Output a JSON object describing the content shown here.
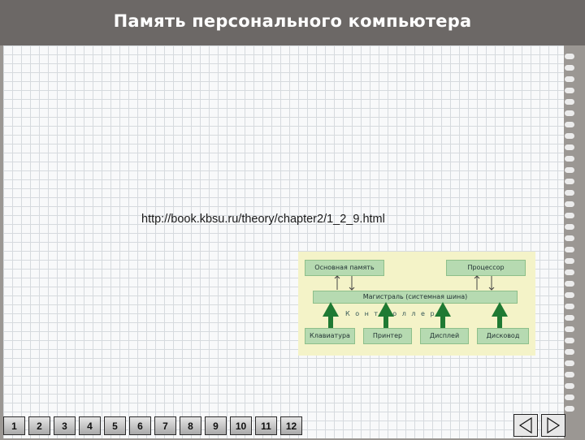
{
  "header": {
    "title": "Память персонального компьютера"
  },
  "content": {
    "url": "http://book.kbsu.ru/theory/chapter2/1_2_9.html"
  },
  "diagram": {
    "memory": "Основная память",
    "processor": "Процессор",
    "bus": "Магистраль (системная шина)",
    "controllers": "К о н т р о л л е р ы",
    "devices": [
      "Клавиатура",
      "Принтер",
      "Дисплей",
      "Дисковод"
    ]
  },
  "navigation": {
    "pages": [
      "1",
      "2",
      "3",
      "4",
      "5",
      "6",
      "7",
      "8",
      "9",
      "10",
      "11",
      "12"
    ],
    "prev_icon": "triangle-left-icon",
    "next_icon": "triangle-right-icon"
  },
  "colors": {
    "header": "#6c6866",
    "diagram_bg": "#f4f3c8",
    "diagram_box": "#b6dab1",
    "arrow_green": "#1f7a33"
  }
}
